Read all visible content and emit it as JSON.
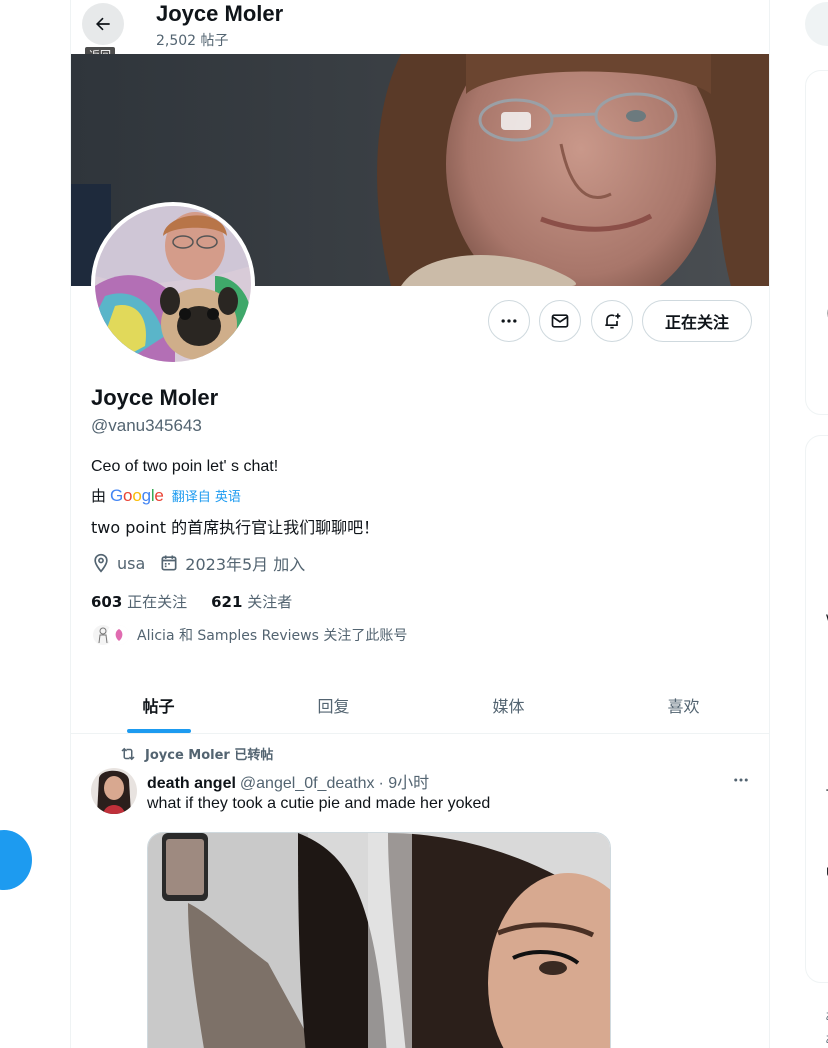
{
  "header": {
    "back_tooltip": "返回",
    "title": "Joyce Moler",
    "post_count": "2,502 帖子"
  },
  "profile": {
    "display_name": "Joyce Moler",
    "handle": "@vanu345643",
    "bio": "Ceo of two poin let' s chat!",
    "translated_by_prefix": "由",
    "translated_by_brand": "Google",
    "translate_link": "翻译自 英语",
    "bio_translation": "two point 的首席执行官让我们聊聊吧！",
    "location": "usa",
    "joined": "2023年5月 加入",
    "following_count": "603",
    "following_label": "正在关注",
    "followers_count": "621",
    "followers_label": "关注者",
    "followed_by": "Alicia 和 Samples Reviews 关注了此账号",
    "follow_button": "正在关注"
  },
  "tabs": [
    {
      "label": "帖子",
      "active": true
    },
    {
      "label": "回复",
      "active": false
    },
    {
      "label": "媒体",
      "active": false
    },
    {
      "label": "喜欢",
      "active": false
    }
  ],
  "tweet": {
    "repost_label": "Joyce Moler 已转帖",
    "author_name": "death angel",
    "author_handle": "@angel_0f_deathx",
    "time": "· 9小时",
    "text": "what if they took a cutie pie and made her yoked"
  },
  "right_column": {
    "fragments": [
      "(",
      "W",
      "T",
      "U",
      "ぁ",
      "ぁ",
      "ぇ"
    ]
  },
  "colors": {
    "accent": "#1d9bf0",
    "muted_text": "#536471",
    "border": "#cfd9de"
  },
  "icons": [
    "back-arrow-icon",
    "more-icon",
    "mail-icon",
    "bell-plus-icon",
    "location-icon",
    "calendar-icon",
    "retweet-icon"
  ]
}
